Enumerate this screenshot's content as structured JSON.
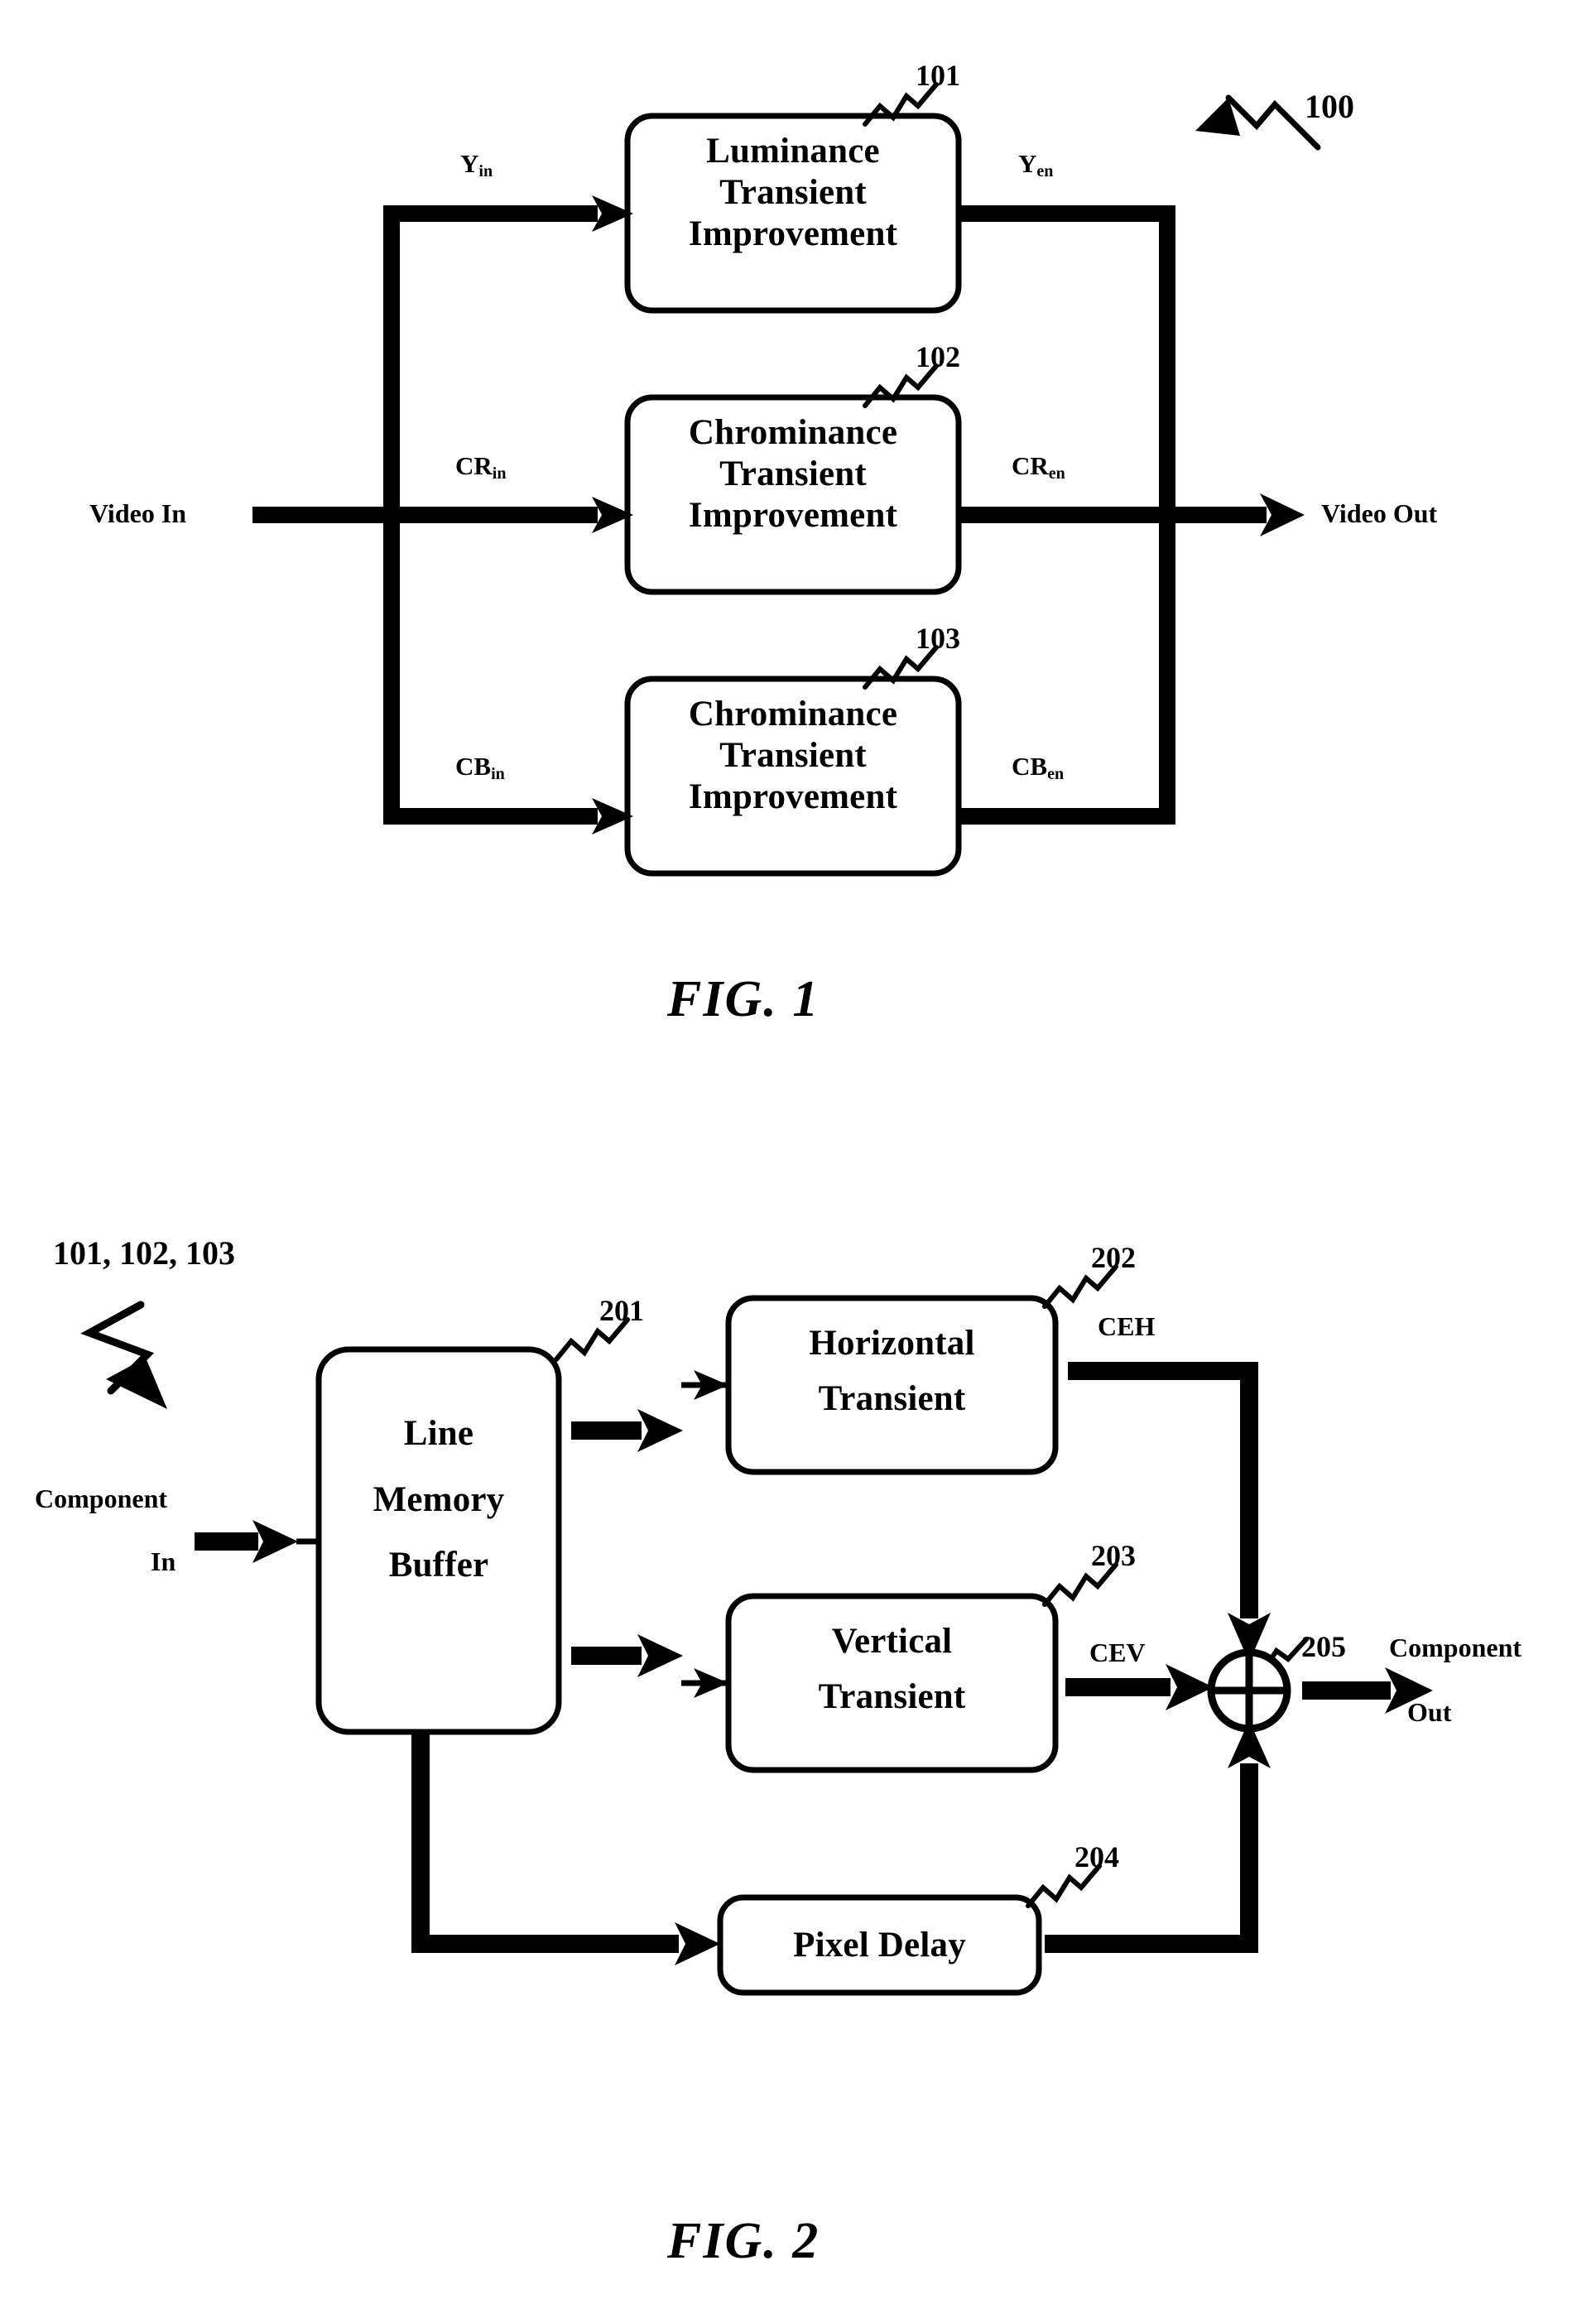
{
  "document": {
    "type": "patent-drawing-sheet",
    "figures": [
      "FIG. 1",
      "FIG. 2"
    ]
  },
  "fig1": {
    "caption": "FIG.  1",
    "system_ref": "100",
    "input_port": "Video In",
    "output_port": "Video Out",
    "blocks": [
      {
        "ref": "101",
        "lines": [
          "Luminance",
          "Transient",
          "Improvement"
        ],
        "in_signal": "Y",
        "in_sub": "in",
        "out_signal": "Y",
        "out_sub": "en"
      },
      {
        "ref": "102",
        "lines": [
          "Chrominance",
          "Transient",
          "Improvement"
        ],
        "in_signal": "CR",
        "in_sub": "in",
        "out_signal": "CR",
        "out_sub": "en"
      },
      {
        "ref": "103",
        "lines": [
          "Chrominance",
          "Transient",
          "Improvement"
        ],
        "in_signal": "CB",
        "in_sub": "in",
        "out_signal": "CB",
        "out_sub": "en"
      }
    ]
  },
  "fig2": {
    "caption": "FIG.  2",
    "system_ref": "101, 102, 103",
    "input_port_line1": "Component",
    "input_port_line2": "In",
    "output_port_line1": "Component",
    "output_port_line2": "Out",
    "blocks": [
      {
        "ref": "201",
        "lines": [
          "Line",
          "Memory",
          "Buffer"
        ]
      },
      {
        "ref": "202",
        "lines": [
          "Horizontal",
          "Transient"
        ],
        "out_signal": "CEH"
      },
      {
        "ref": "203",
        "lines": [
          "Vertical",
          "Transient"
        ],
        "out_signal": "CEV"
      },
      {
        "ref": "204",
        "lines": [
          "Pixel Delay"
        ]
      }
    ],
    "adder_ref": "205"
  },
  "style": {
    "ink": "#000000",
    "paper": "#ffffff"
  }
}
